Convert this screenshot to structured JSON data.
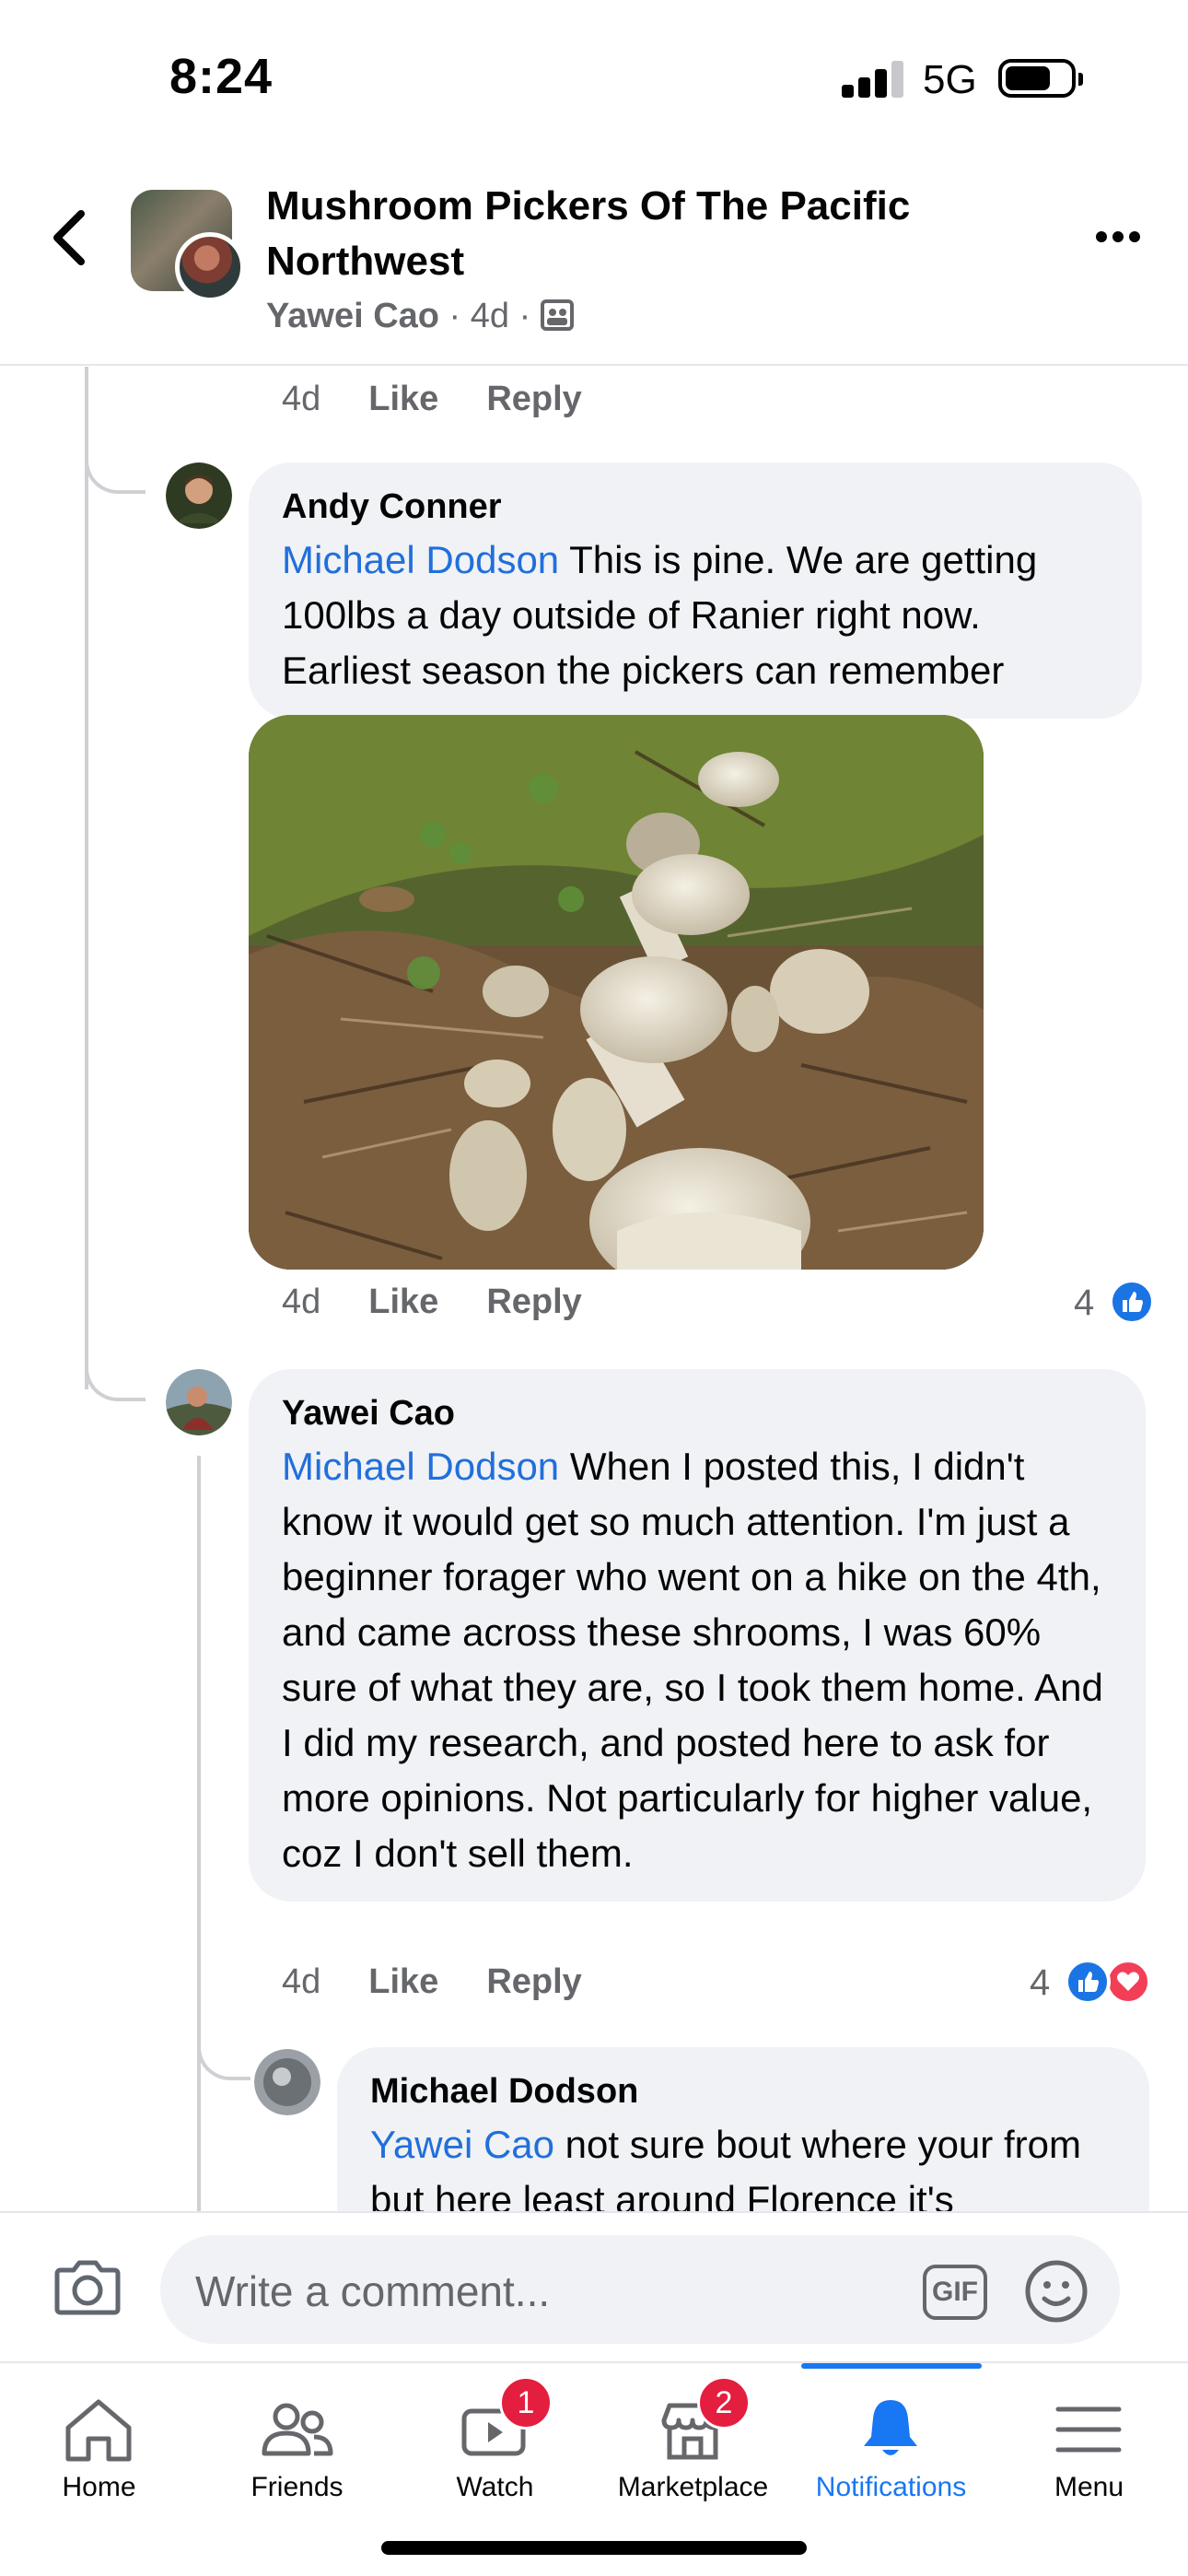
{
  "status_bar": {
    "time": "8:24",
    "network": "5G"
  },
  "header": {
    "group_name": "Mushroom Pickers Of The Pacific Northwest",
    "author": "Yawei Cao",
    "age": "4d",
    "separator": "·"
  },
  "comments": [
    {
      "id": "prev",
      "time": "4d",
      "like": "Like",
      "reply": "Reply"
    },
    {
      "id": "andy",
      "author": "Andy Conner",
      "mention": "Michael Dodson",
      "text": " This is pine. We are getting 100lbs a day outside of Ranier right now. Earliest season the pickers can remember",
      "time": "4d",
      "like": "Like",
      "reply": "Reply",
      "reaction_count": "4"
    },
    {
      "id": "yawei",
      "author": "Yawei Cao",
      "mention": "Michael Dodson",
      "text": " When I posted this, I didn't know it would get so much attention. I'm just a beginner forager who went on a hike on the 4th, and came across these shrooms, I was 60% sure of what they are, so I took them home. And I did my research, and posted here to ask for more opinions. Not particularly for higher value, coz I don't sell them.",
      "time": "4d",
      "like": "Like",
      "reply": "Reply",
      "reaction_count": "4"
    },
    {
      "id": "michael",
      "author": "Michael Dodson",
      "mention": "Yawei Cao",
      "text": " not sure bout where your from but here least around Florence it's"
    }
  ],
  "composer": {
    "placeholder": "Write a comment...",
    "gif_label": "GIF"
  },
  "tabs": [
    {
      "label": "Home"
    },
    {
      "label": "Friends"
    },
    {
      "label": "Watch",
      "badge": "1"
    },
    {
      "label": "Marketplace",
      "badge": "2"
    },
    {
      "label": "Notifications"
    },
    {
      "label": "Menu"
    }
  ],
  "colors": {
    "accent": "#1877f2",
    "mention": "#216fdb",
    "bubble": "#f0f2f5",
    "badge": "#e41e3f",
    "love": "#f33e58"
  }
}
